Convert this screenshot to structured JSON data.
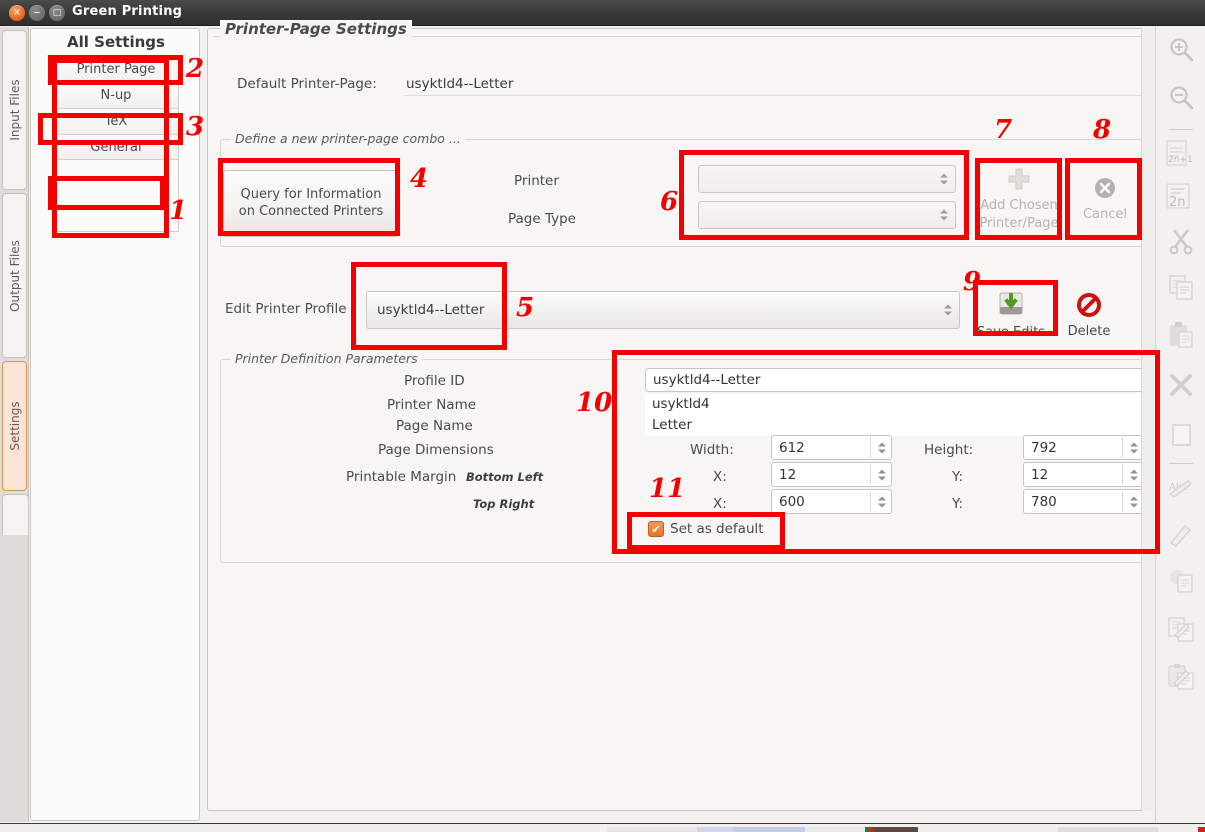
{
  "window": {
    "title": "Green Printing",
    "buttons": {
      "close": "×",
      "minimize": "–",
      "maximize": "□"
    }
  },
  "vertical_tabs": [
    {
      "label": "Input Files",
      "selected": false
    },
    {
      "label": "Output Files",
      "selected": false
    },
    {
      "label": "Settings",
      "selected": true
    }
  ],
  "sidebar": {
    "title": "All Settings",
    "items": [
      {
        "label": "Printer Page",
        "selected": true
      },
      {
        "label": "N-up",
        "selected": false
      },
      {
        "label": "TeX",
        "selected": false
      },
      {
        "label": "General",
        "selected": false
      }
    ]
  },
  "main": {
    "panel_title": "Printer-Page Settings",
    "default_printer_page": {
      "label": "Default Printer-Page:",
      "value": "usyktld4--Letter"
    },
    "define_group": {
      "legend": "Define a new printer-page combo ...",
      "query_button": "Query for Information\non Connected Printers",
      "query_button_line1": "Query for Information",
      "query_button_line2": "on Connected Printers",
      "printer_label": "Printer",
      "printer_value": "",
      "page_type_label": "Page Type",
      "page_type_value": "",
      "add_button_line1": "Add Chosen",
      "add_button_line2": "Printer/Page",
      "add_button_icon": "plus-icon",
      "cancel_button": "Cancel",
      "cancel_button_icon": "cancel-circle-icon"
    },
    "edit_profile": {
      "label": "Edit Printer Profile",
      "value": "usyktld4--Letter",
      "save_button": "Save Edits",
      "save_button_icon": "save-disk-icon",
      "delete_button": "Delete",
      "delete_button_icon": "delete-prohibited-icon"
    },
    "params_group": {
      "legend": "Printer Definition Parameters",
      "labels": {
        "profile_id": "Profile ID",
        "printer_name": "Printer Name",
        "page_name": "Page Name",
        "page_dimensions": "Page Dimensions",
        "printable_margin": "Printable Margin",
        "bottom_left": "Bottom Left",
        "top_right": "Top Right"
      },
      "values": {
        "profile_id": "usyktld4--Letter",
        "printer_name": "usyktld4",
        "page_name": "Letter",
        "width_label": "Width:",
        "width": "612",
        "height_label": "Height:",
        "height": "792",
        "bl_x_label": "X:",
        "bl_x": "12",
        "bl_y_label": "Y:",
        "bl_y": "12",
        "tr_x_label": "X:",
        "tr_x": "600",
        "tr_y_label": "Y:",
        "tr_y": "780",
        "set_default_label": "Set as default",
        "set_default_checked": true,
        "checkmark": "✔"
      }
    }
  },
  "toolbar": {
    "items": [
      {
        "name": "zoom-in-icon"
      },
      {
        "name": "zoom-out-icon"
      },
      {
        "name": "odd-pages-icon",
        "text": "2n+1"
      },
      {
        "name": "even-pages-icon",
        "text": "2n"
      },
      {
        "name": "cut-icon"
      },
      {
        "name": "copy-icon"
      },
      {
        "name": "paste-icon"
      },
      {
        "name": "delete-x-icon"
      },
      {
        "name": "blank-page-icon"
      },
      {
        "name": "annotate-text-icon",
        "text": "Abc"
      },
      {
        "name": "highlight-pen-icon"
      },
      {
        "name": "copy-annotation-icon"
      },
      {
        "name": "paste-annotation-icon"
      },
      {
        "name": "clipboard-annotation-icon"
      }
    ]
  },
  "annotations": [
    {
      "num": "1"
    },
    {
      "num": "2"
    },
    {
      "num": "3"
    },
    {
      "num": "4"
    },
    {
      "num": "5"
    },
    {
      "num": "6"
    },
    {
      "num": "7"
    },
    {
      "num": "8"
    },
    {
      "num": "9"
    },
    {
      "num": "10"
    },
    {
      "num": "11"
    }
  ],
  "colors": {
    "annotation_red": "#f40000",
    "accent_orange": "#e2762a",
    "window_chrome": "#393937"
  }
}
